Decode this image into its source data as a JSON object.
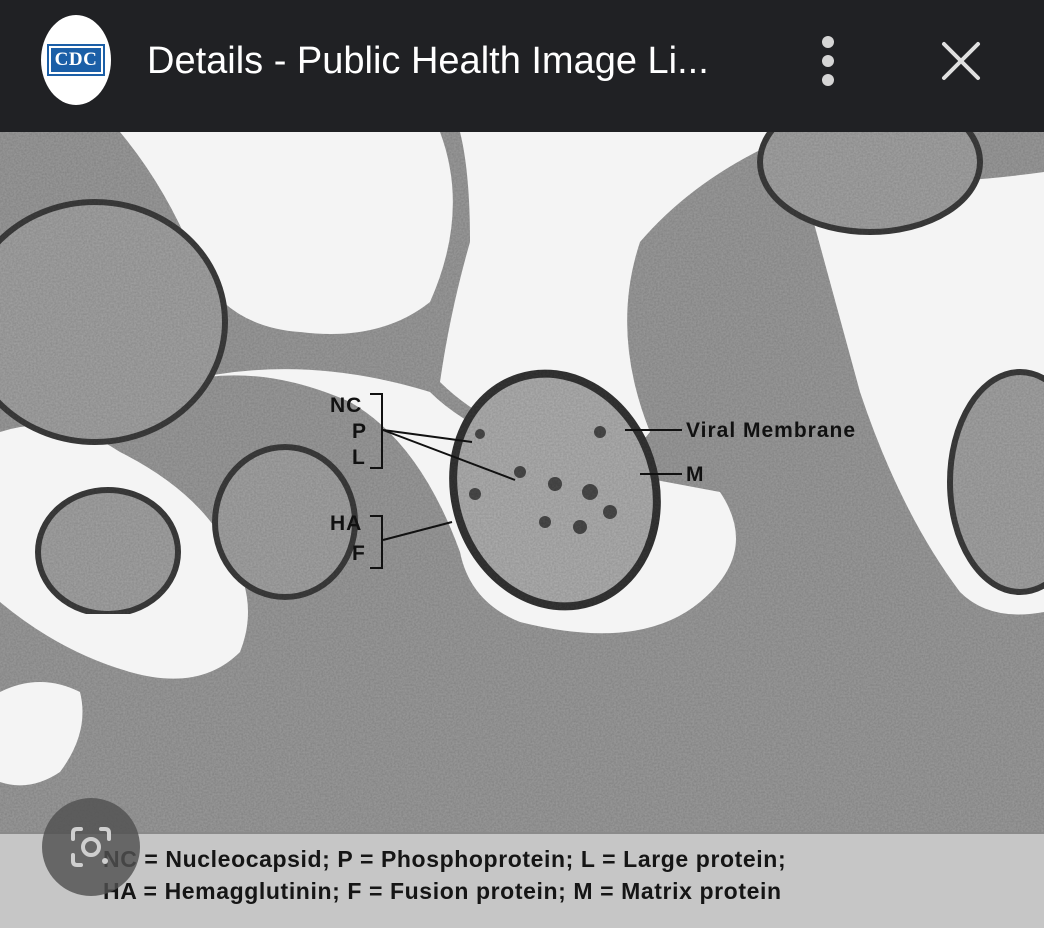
{
  "header": {
    "logo_text": "CDC",
    "title": "Details - Public Health Image Li...",
    "menu_icon": "more-vert-icon",
    "close_icon": "close-icon"
  },
  "image": {
    "labels": {
      "nc": "NC",
      "p": "P",
      "l": "L",
      "ha": "HA",
      "f": "F",
      "viral_membrane": "Viral Membrane",
      "m": "M"
    },
    "caption": {
      "line1": "NC = Nucleocapsid; P = Phosphoprotein; L = Large protein;",
      "line2": "HA = Hemagglutinin; F = Fusion protein; M = Matrix protein"
    }
  },
  "overlay": {
    "lens_icon": "google-lens-icon"
  }
}
